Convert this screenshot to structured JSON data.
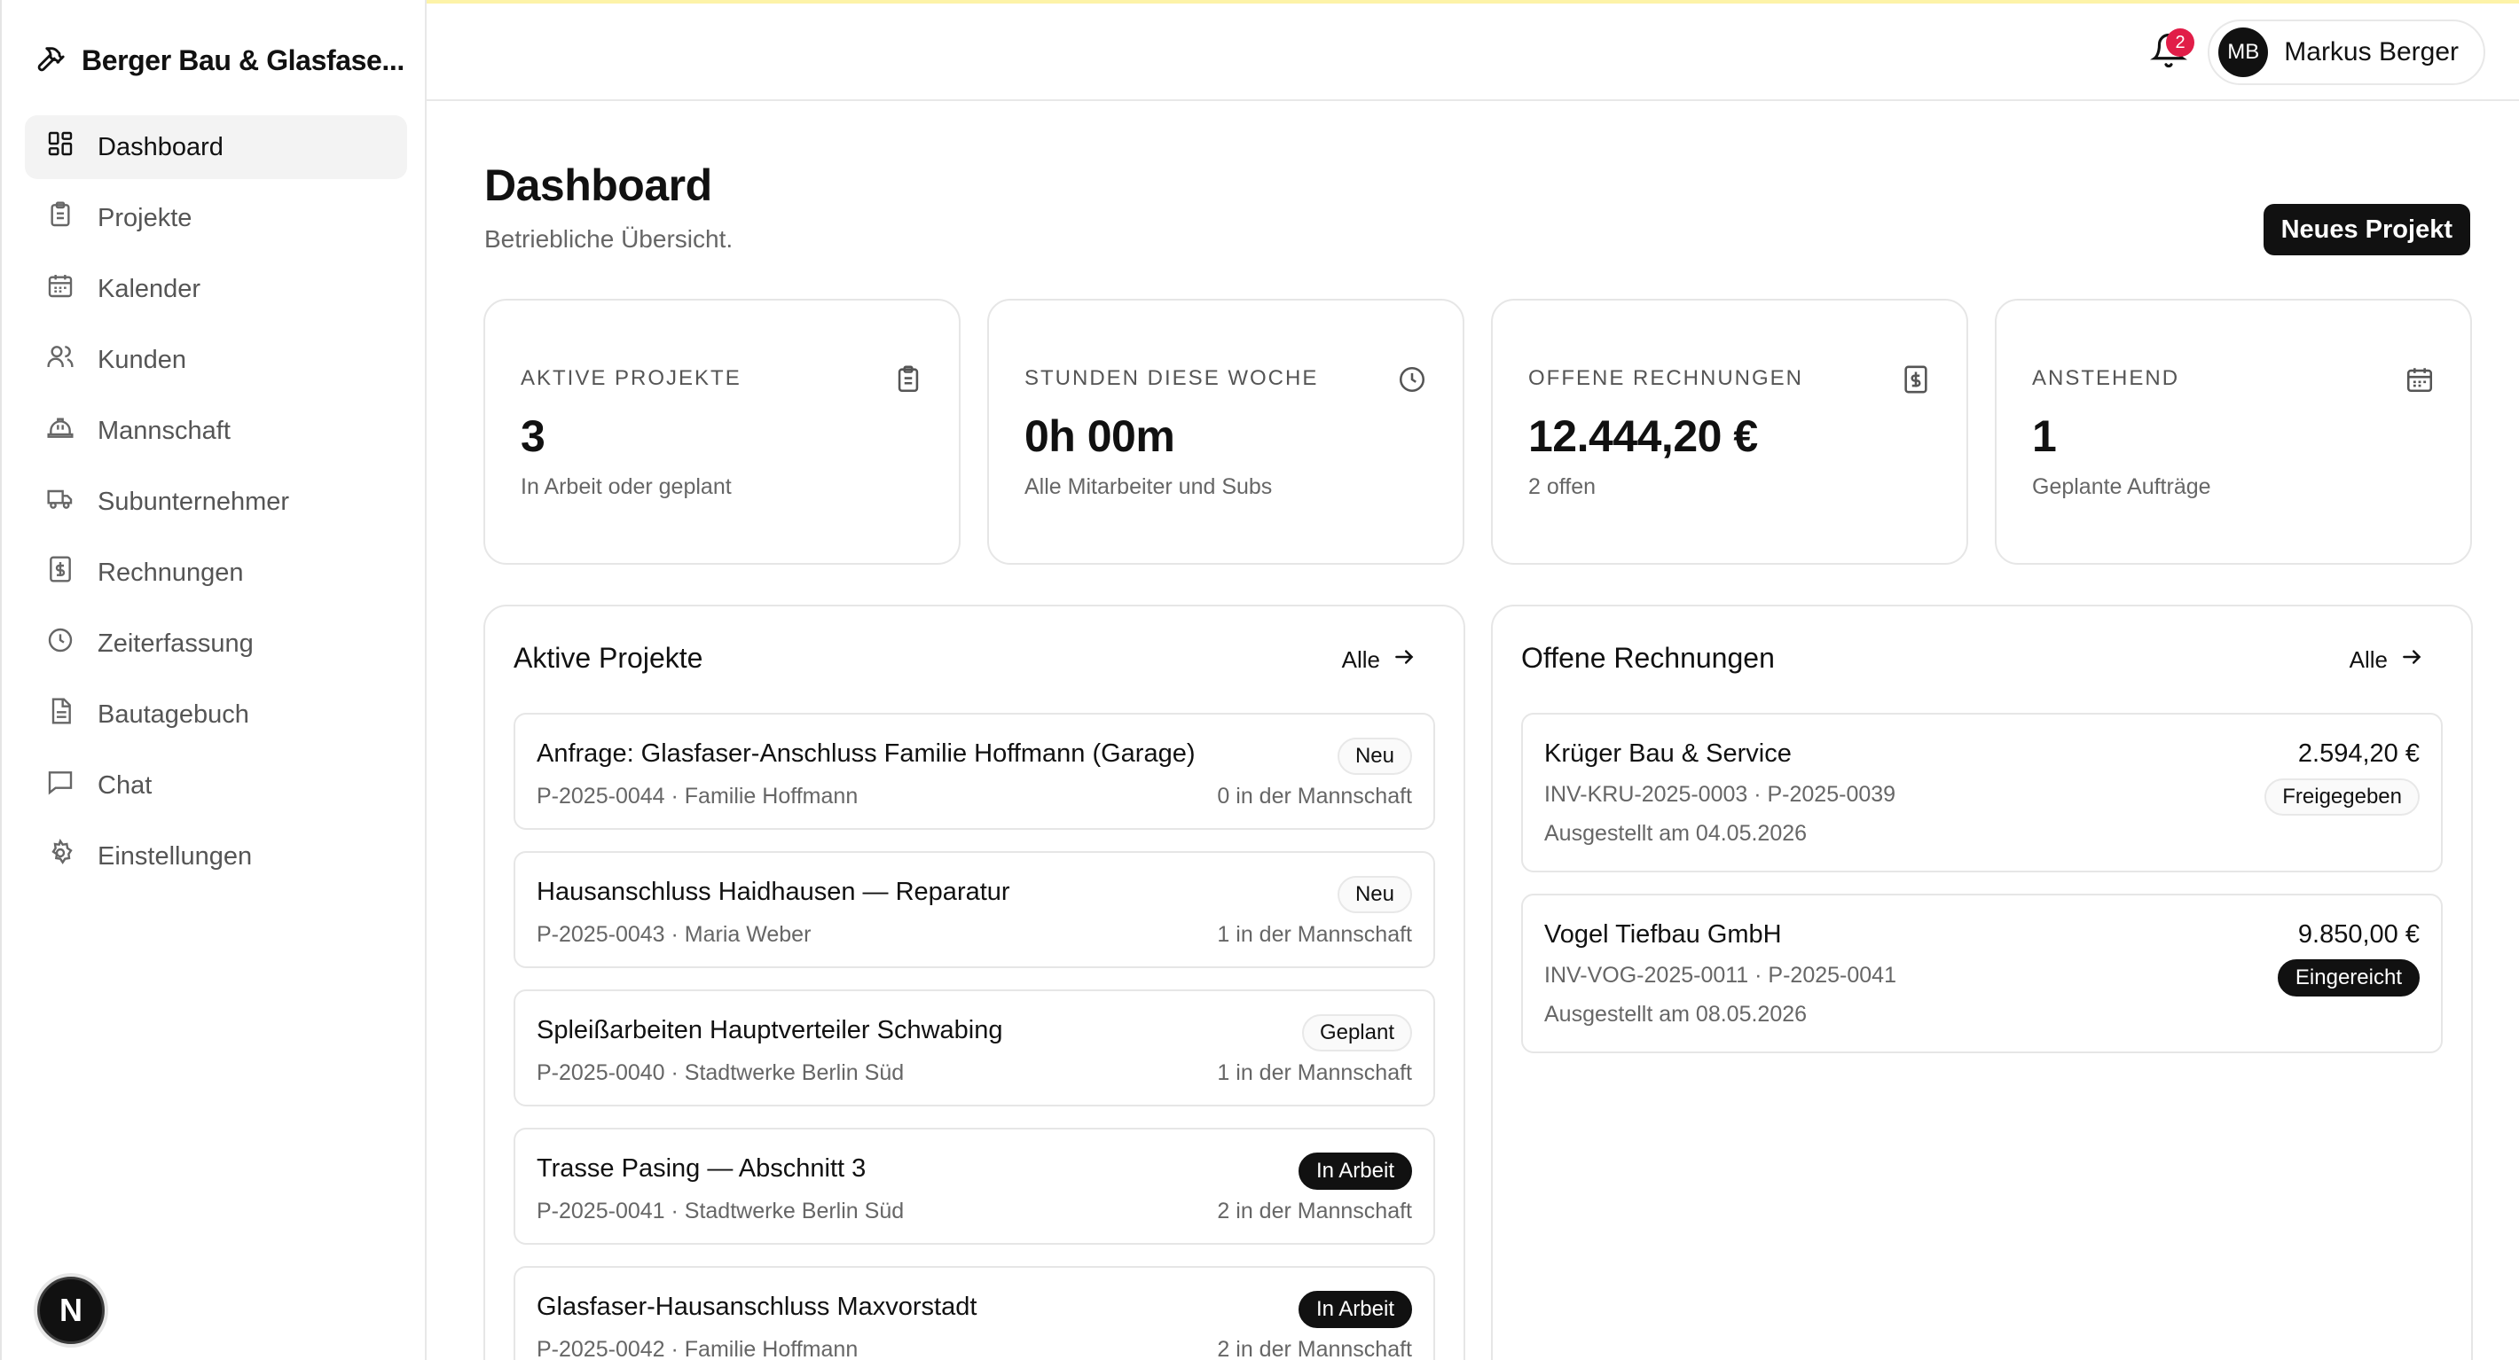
{
  "brand": {
    "name": "Berger Bau & Glasfase..."
  },
  "sidebar": {
    "items": [
      {
        "label": "Dashboard"
      },
      {
        "label": "Projekte"
      },
      {
        "label": "Kalender"
      },
      {
        "label": "Kunden"
      },
      {
        "label": "Mannschaft"
      },
      {
        "label": "Subunternehmer"
      },
      {
        "label": "Rechnungen"
      },
      {
        "label": "Zeiterfassung"
      },
      {
        "label": "Bautagebuch"
      },
      {
        "label": "Chat"
      },
      {
        "label": "Einstellungen"
      }
    ],
    "active_index": 0
  },
  "dev_badge": {
    "letter": "N"
  },
  "header": {
    "notification_count": "2",
    "user": {
      "initials": "MB",
      "name": "Markus Berger"
    }
  },
  "page": {
    "title": "Dashboard",
    "subtitle": "Betriebliche Übersicht.",
    "new_project_label": "Neues Projekt"
  },
  "stats": [
    {
      "label": "AKTIVE PROJEKTE",
      "value": "3",
      "sub": "In Arbeit oder geplant",
      "icon": "clipboard-icon"
    },
    {
      "label": "STUNDEN DIESE WOCHE",
      "value": "0h 00m",
      "sub": "Alle Mitarbeiter und Subs",
      "icon": "clock-icon"
    },
    {
      "label": "OFFENE RECHNUNGEN",
      "value": "12.444,20 €",
      "sub": "2 offen",
      "icon": "invoice-dollar-icon"
    },
    {
      "label": "ANSTEHEND",
      "value": "1",
      "sub": "Geplante Aufträge",
      "icon": "calendar-icon"
    }
  ],
  "projects_panel": {
    "title": "Aktive Projekte",
    "link_label": "Alle",
    "items": [
      {
        "title": "Anfrage: Glasfaser-Anschluss Familie Hoffmann (Garage)",
        "meta": "P-2025-0044 · Familie Hoffmann",
        "team": "0 in der Mannschaft",
        "status": "Neu"
      },
      {
        "title": "Hausanschluss Haidhausen — Reparatur",
        "meta": "P-2025-0043 · Maria Weber",
        "team": "1 in der Mannschaft",
        "status": "Neu"
      },
      {
        "title": "Spleißarbeiten Hauptverteiler Schwabing",
        "meta": "P-2025-0040 · Stadtwerke Berlin Süd",
        "team": "1 in der Mannschaft",
        "status": "Geplant"
      },
      {
        "title": "Trasse Pasing — Abschnitt 3",
        "meta": "P-2025-0041 · Stadtwerke Berlin Süd",
        "team": "2 in der Mannschaft",
        "status": "In Arbeit"
      },
      {
        "title": "Glasfaser-Hausanschluss Maxvorstadt",
        "meta": "P-2025-0042 · Familie Hoffmann",
        "team": "2 in der Mannschaft",
        "status": "In Arbeit"
      }
    ]
  },
  "invoices_panel": {
    "title": "Offene Rechnungen",
    "link_label": "Alle",
    "items": [
      {
        "name": "Krüger Bau & Service",
        "amount": "2.594,20 €",
        "meta": "INV-KRU-2025-0003 · P-2025-0039",
        "date": "Ausgestellt am 04.05.2026",
        "status": "Freigegeben"
      },
      {
        "name": "Vogel Tiefbau GmbH",
        "amount": "9.850,00 €",
        "meta": "INV-VOG-2025-0011 · P-2025-0041",
        "date": "Ausgestellt am 08.05.2026",
        "status": "Eingereicht"
      }
    ]
  },
  "colors": {
    "accent": "#111111",
    "notification": "#e11d48",
    "muted_text": "#666666",
    "border": "#e6e6e6"
  }
}
